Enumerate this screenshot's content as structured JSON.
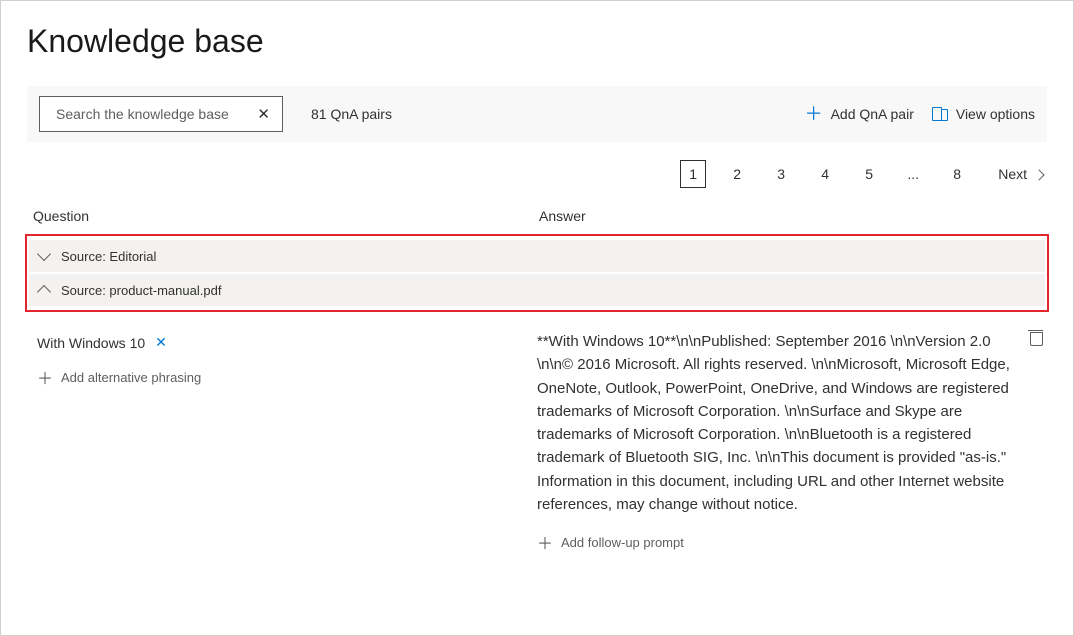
{
  "page": {
    "title": "Knowledge base"
  },
  "toolbar": {
    "search_placeholder": "Search the knowledge base",
    "count_label": "81 QnA pairs",
    "add_pair_label": "Add QnA pair",
    "view_options_label": "View options"
  },
  "pager": {
    "pages": [
      "1",
      "2",
      "3",
      "4",
      "5",
      "...",
      "8"
    ],
    "current": "1",
    "next_label": "Next"
  },
  "columns": {
    "question": "Question",
    "answer": "Answer"
  },
  "sources": [
    {
      "label": "Source: Editorial",
      "expanded": false
    },
    {
      "label": "Source: product-manual.pdf",
      "expanded": true
    }
  ],
  "qa": {
    "question_chip": "With Windows 10",
    "add_phrasing_label": "Add alternative phrasing",
    "answer": "**With Windows 10**\\n\\nPublished: September 2016 \\n\\nVersion 2.0 \\n\\n© 2016 Microsoft. All rights reserved. \\n\\nMicrosoft, Microsoft Edge, OneNote, Outlook, PowerPoint, OneDrive, and Windows are registered trademarks of Microsoft Corporation. \\n\\nSurface and Skype are trademarks of Microsoft Corporation. \\n\\nBluetooth is a registered trademark of Bluetooth SIG, Inc. \\n\\nThis document is provided \"as-is.\" Information in this document, including URL and other Internet website references, may change without notice.",
    "add_followup_label": "Add follow-up prompt"
  }
}
